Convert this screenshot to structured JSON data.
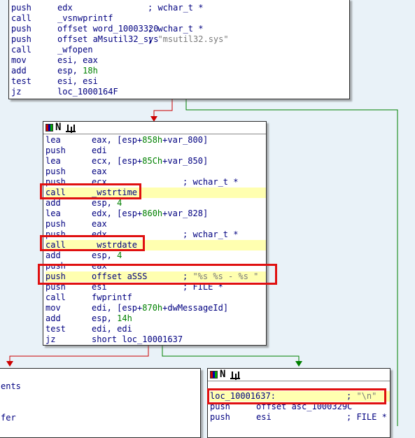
{
  "top_block": {
    "lines": [
      {
        "mn": "push",
        "op": "edx",
        "cm": "; wchar_t *"
      },
      {
        "mn": "call",
        "op": "_vsnwprintf",
        "cm": ""
      },
      {
        "mn": "push",
        "op": "offset word_10003320",
        "cm": "; wchar_t *"
      },
      {
        "mn": "push",
        "op": "offset aMsutil32_sys",
        "cm": "; \"msutil32.sys\""
      },
      {
        "mn": "call",
        "op": "_wfopen",
        "cm": ""
      },
      {
        "mn": "mov",
        "op": "esi, eax",
        "cm": ""
      },
      {
        "mn": "add",
        "op": "esp, 18h",
        "cm": ""
      },
      {
        "mn": "test",
        "op": "esi, esi",
        "cm": ""
      },
      {
        "mn": "jz",
        "op": "loc_1000164F",
        "cm": ""
      }
    ]
  },
  "mid_block": {
    "title_icons": [
      "color-grid-icon",
      "n-icon",
      "graph-icon"
    ],
    "lines": [
      {
        "mn": "lea",
        "op": "eax, [esp+858h+var_800]",
        "cm": ""
      },
      {
        "mn": "push",
        "op": "edi",
        "cm": ""
      },
      {
        "mn": "lea",
        "op": "ecx, [esp+85Ch+var_850]",
        "cm": ""
      },
      {
        "mn": "push",
        "op": "eax",
        "cm": ""
      },
      {
        "mn": "push",
        "op": "ecx",
        "cm": "; wchar_t *"
      },
      {
        "mn": "call",
        "op": "_wstrtime",
        "cm": ""
      },
      {
        "mn": "add",
        "op": "esp, 4",
        "cm": ""
      },
      {
        "mn": "lea",
        "op": "edx, [esp+860h+var_828]",
        "cm": ""
      },
      {
        "mn": "push",
        "op": "eax",
        "cm": ""
      },
      {
        "mn": "push",
        "op": "edx",
        "cm": "; wchar_t *"
      },
      {
        "mn": "call",
        "op": "_wstrdate",
        "cm": ""
      },
      {
        "mn": "add",
        "op": "esp, 4",
        "cm": ""
      },
      {
        "mn": "push",
        "op": "eax",
        "cm": ""
      },
      {
        "mn": "push",
        "op": "offset aSSS",
        "cm": "; \"%s %s - %s \""
      },
      {
        "mn": "push",
        "op": "esi",
        "cm": "; FILE *"
      },
      {
        "mn": "call",
        "op": "fwprintf",
        "cm": ""
      },
      {
        "mn": "mov",
        "op": "edi, [esp+870h+dwMessageId]",
        "cm": ""
      },
      {
        "mn": "add",
        "op": "esp, 14h",
        "cm": ""
      },
      {
        "mn": "test",
        "op": "edi, edi",
        "cm": ""
      },
      {
        "mn": "jz",
        "op": "short loc_10001637",
        "cm": ""
      }
    ]
  },
  "left_block": {
    "lines": [
      "ents",
      "",
      "",
      "fer"
    ]
  },
  "right_block": {
    "title_icons": [
      "color-grid-icon",
      "n-icon",
      "graph-icon"
    ],
    "lines": [
      {
        "label": "loc_10001637:",
        "cm": "; \"\\n\""
      },
      {
        "mn": "push",
        "op": "offset asc_1000329C",
        "cm": ""
      },
      {
        "mn": "push",
        "op": "esi",
        "cm": "; FILE *"
      }
    ]
  },
  "colors": {
    "background": "#e9f2f8",
    "highlight": "#ffffb0",
    "box": "#e01010",
    "edge_true": "#008000",
    "edge_false": "#cc0000",
    "text": "#000080"
  }
}
